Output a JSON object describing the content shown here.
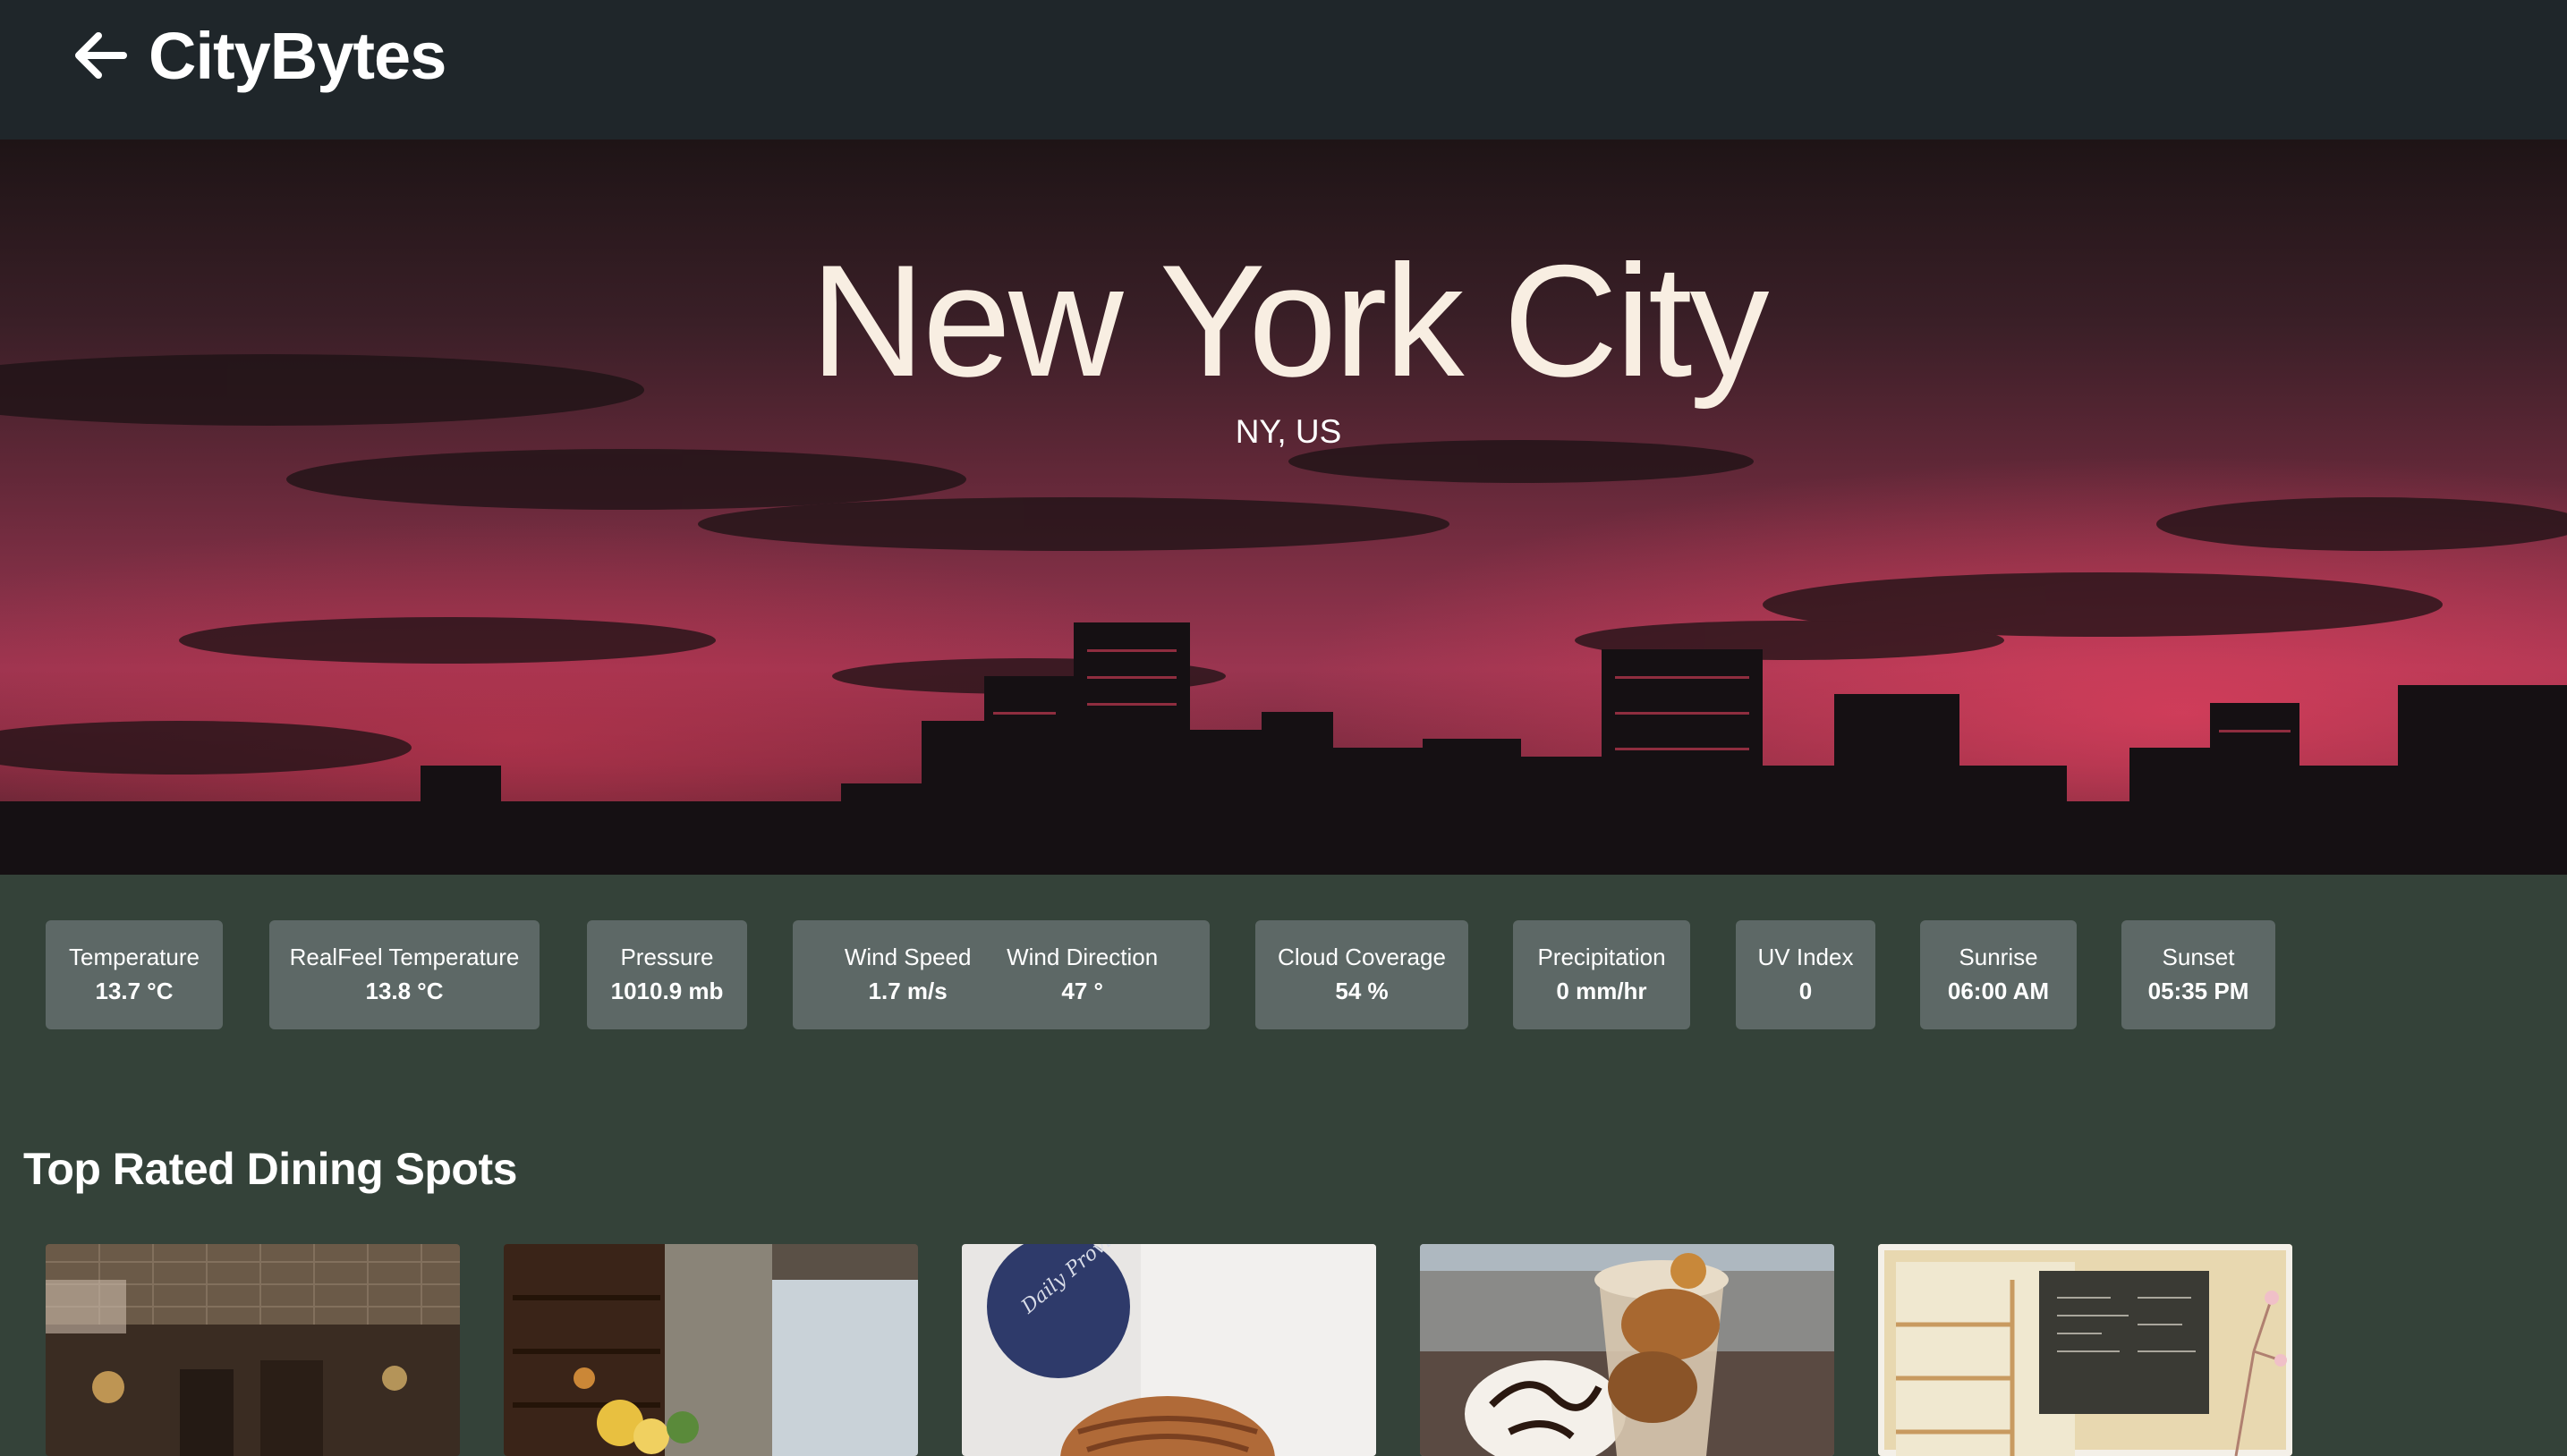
{
  "app": {
    "brand": "CityBytes",
    "back_icon": "arrow-left-icon"
  },
  "hero": {
    "city": "New York City",
    "region": "NY, US"
  },
  "weather": [
    {
      "label": "Temperature",
      "value": "13.7 °C"
    },
    {
      "label": "RealFeel Temperature",
      "value": "13.8 °C"
    },
    {
      "label": "Pressure",
      "value": "1010.9 mb"
    },
    {
      "label": "Wind Speed",
      "value": "1.7 m/s"
    },
    {
      "label": "Wind Direction",
      "value": "47 °"
    },
    {
      "label": "Cloud Coverage",
      "value": "54 %"
    },
    {
      "label": "Precipitation",
      "value": "0 mm/hr"
    },
    {
      "label": "UV Index",
      "value": "0"
    },
    {
      "label": "Sunrise",
      "value": "06:00 AM"
    },
    {
      "label": "Sunset",
      "value": "05:35 PM"
    }
  ],
  "dining": {
    "title": "Top Rated Dining Spots",
    "badge_text": "Daily Provisions"
  },
  "colors": {
    "topbar": "#1f262a",
    "page": "#344239",
    "stat_card": "#5d6866",
    "hero_title": "#f8eee2"
  }
}
